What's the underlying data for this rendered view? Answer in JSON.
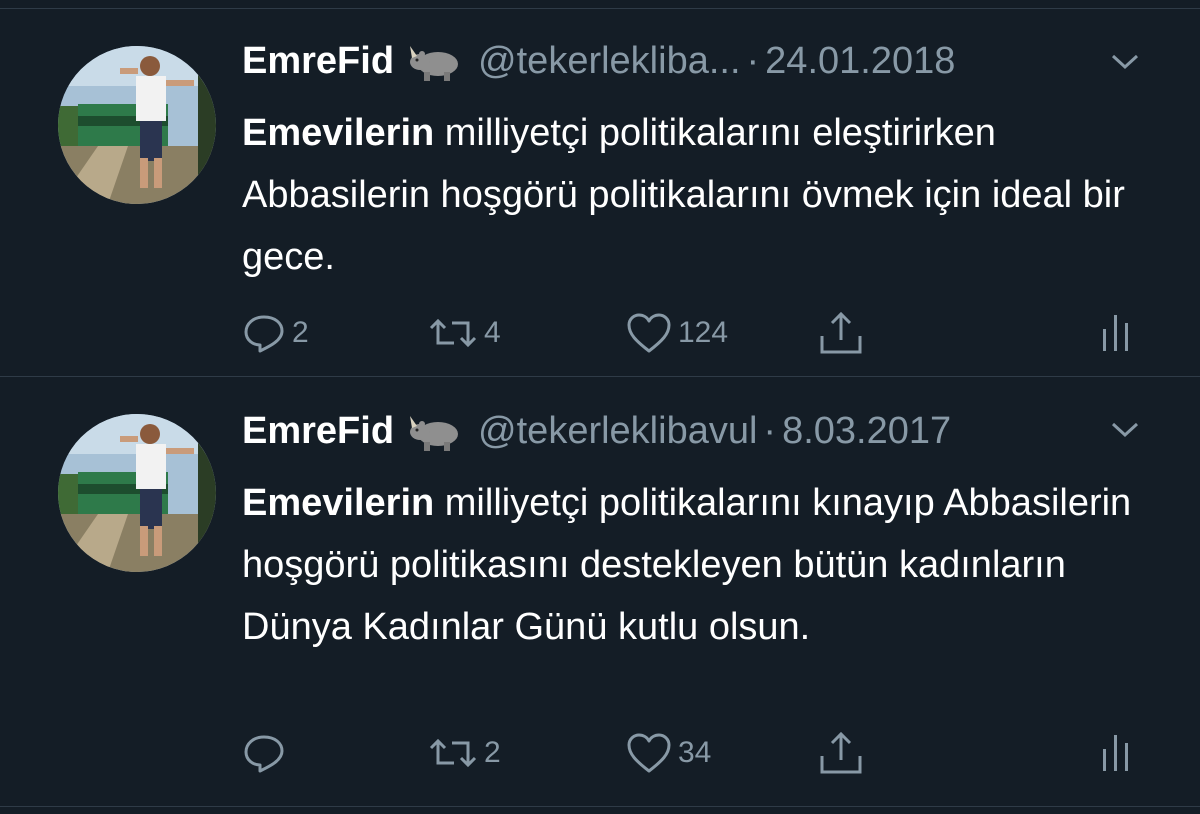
{
  "tweets": [
    {
      "name": "EmreFid",
      "emoji_icon": "rhinoceros-emoji",
      "handle": "@tekerlekliba...",
      "separator": "·",
      "date": "24.01.2018",
      "text_lead": "Emevilerin",
      "text_rest": " milliyetçi politikalarını eleştirirken Abbasilerin hoşgörü politikalarını övmek için ideal bir gece.",
      "replies": "2",
      "retweets": "4",
      "likes": "124"
    },
    {
      "name": "EmreFid",
      "emoji_icon": "rhinoceros-emoji",
      "handle": "@tekerleklibavul",
      "separator": "·",
      "date": "8.03.2017",
      "text_lead": "Emevilerin",
      "text_rest": " milliyetçi politikalarını kınayıp Abbasilerin hoşgörü politikasını destekleyen bütün kadınların Dünya Kadınlar Günü kutlu olsun.",
      "replies": "",
      "retweets": "2",
      "likes": "34"
    }
  ],
  "colors": {
    "background": "#141d26",
    "text": "#ffffff",
    "muted": "#8899a6",
    "divider": "#2f3b47"
  }
}
